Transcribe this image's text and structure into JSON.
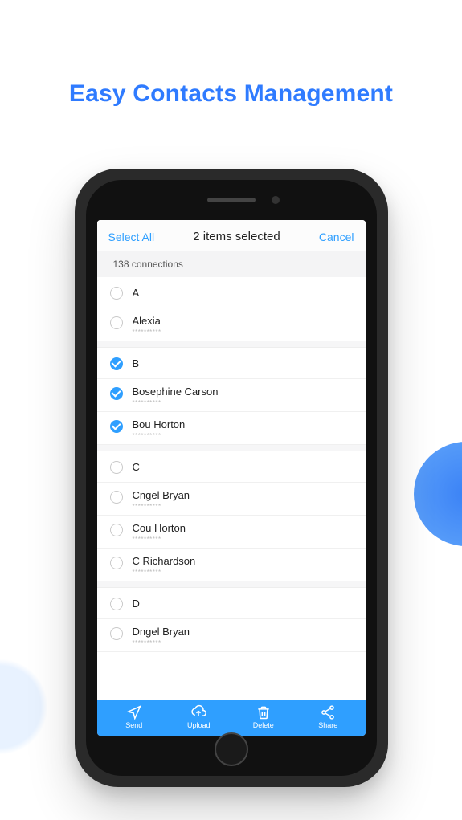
{
  "headline": "Easy Contacts Management",
  "nav": {
    "left": "Select All",
    "title": "2 items selected",
    "right": "Cancel"
  },
  "subheader": "138 connections",
  "masked": "**********",
  "sections": [
    {
      "letter": "A",
      "letterSelected": false,
      "items": [
        {
          "name": "Alexia",
          "selected": false
        }
      ]
    },
    {
      "letter": "B",
      "letterSelected": true,
      "items": [
        {
          "name": "Bosephine Carson",
          "selected": true
        },
        {
          "name": "Bou Horton",
          "selected": true
        }
      ]
    },
    {
      "letter": "C",
      "letterSelected": false,
      "items": [
        {
          "name": "Cngel Bryan",
          "selected": false
        },
        {
          "name": "Cou Horton",
          "selected": false
        },
        {
          "name": "C Richardson",
          "selected": false
        }
      ]
    },
    {
      "letter": "D",
      "letterSelected": false,
      "items": [
        {
          "name": "Dngel Bryan",
          "selected": false
        }
      ]
    }
  ],
  "toolbar": {
    "send": "Send",
    "upload": "Upload",
    "delete": "Delete",
    "share": "Share"
  }
}
